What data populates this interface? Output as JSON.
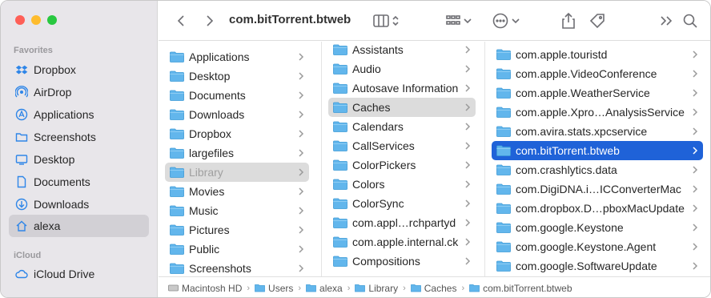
{
  "window": {
    "title": "com.bitTorrent.btweb"
  },
  "sidebar": {
    "favorites_heading": "Favorites",
    "favorites": [
      {
        "label": "Dropbox",
        "icon": "dropbox-icon"
      },
      {
        "label": "AirDrop",
        "icon": "airdrop-icon"
      },
      {
        "label": "Applications",
        "icon": "applications-icon"
      },
      {
        "label": "Screenshots",
        "icon": "folder-icon"
      },
      {
        "label": "Desktop",
        "icon": "desktop-icon"
      },
      {
        "label": "Documents",
        "icon": "document-icon"
      },
      {
        "label": "Downloads",
        "icon": "downloads-icon"
      },
      {
        "label": "alexa",
        "icon": "home-icon"
      }
    ],
    "icloud_heading": "iCloud",
    "icloud": [
      {
        "label": "iCloud Drive",
        "icon": "cloud-icon"
      }
    ]
  },
  "columns": [
    {
      "items": [
        "Applications",
        "Desktop",
        "Documents",
        "Downloads",
        "Dropbox",
        "largefiles",
        "Library",
        "Movies",
        "Music",
        "Pictures",
        "Public",
        "Screenshots"
      ]
    },
    {
      "items": [
        "Assistants",
        "Audio",
        "Autosave Information",
        "Caches",
        "Calendars",
        "CallServices",
        "ColorPickers",
        "Colors",
        "ColorSync",
        "com.appl…rchpartyd",
        "com.apple.internal.ck",
        "Compositions"
      ]
    },
    {
      "items": [
        "com.apple.touristd",
        "com.apple.VideoConference",
        "com.apple.WeatherService",
        "com.apple.Xpro…AnalysisService",
        "com.avira.stats.xpcservice",
        "com.bitTorrent.btweb",
        "com.crashlytics.data",
        "com.DigiDNA.i…ICConverterMac",
        "com.dropbox.D…pboxMacUpdate",
        "com.google.Keystone",
        "com.google.Keystone.Agent",
        "com.google.SoftwareUpdate"
      ]
    }
  ],
  "pathbar": [
    "Macintosh HD",
    "Users",
    "alexa",
    "Library",
    "Caches",
    "com.bitTorrent.btweb"
  ],
  "colors": {
    "accent": "#1f62d8",
    "folder": "#5ab2ea",
    "sidebar": "#e8e6ea"
  }
}
